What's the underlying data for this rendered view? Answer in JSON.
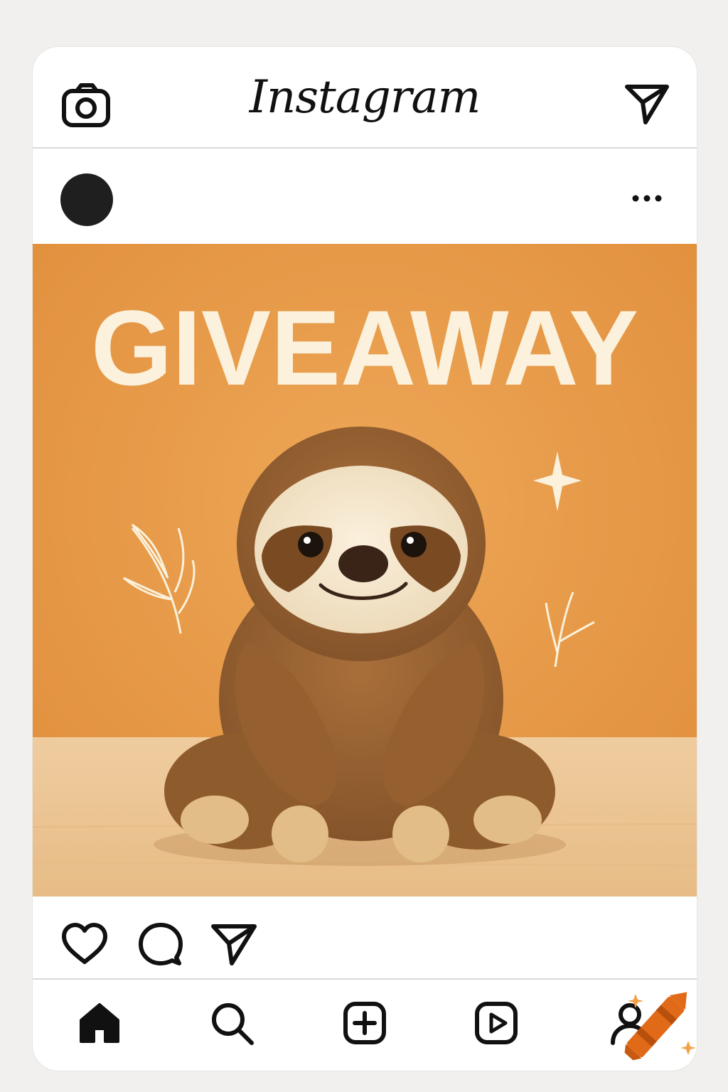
{
  "app": {
    "name": "Instagram"
  },
  "topbar": {
    "camera_icon": "camera-icon",
    "dm_icon": "paper-plane-icon"
  },
  "post": {
    "avatar": "avatar",
    "more_icon": "more-dots-icon",
    "image_headline": "GIVEAWAY",
    "image_subject": "sloth plush"
  },
  "actions": [
    "heart-icon",
    "comment-icon",
    "share-icon"
  ],
  "nav": [
    "home-icon",
    "search-icon",
    "create-icon",
    "reels-icon",
    "profile-icon"
  ],
  "colors": {
    "background": "#f1f0ee",
    "card": "#ffffff",
    "post_bg": "#e79a45",
    "floor": "#ecc594",
    "headline": "#fbf1dc",
    "sloth_fur": "#9a6432",
    "icon": "#111111",
    "crayon": "#e06a17"
  }
}
